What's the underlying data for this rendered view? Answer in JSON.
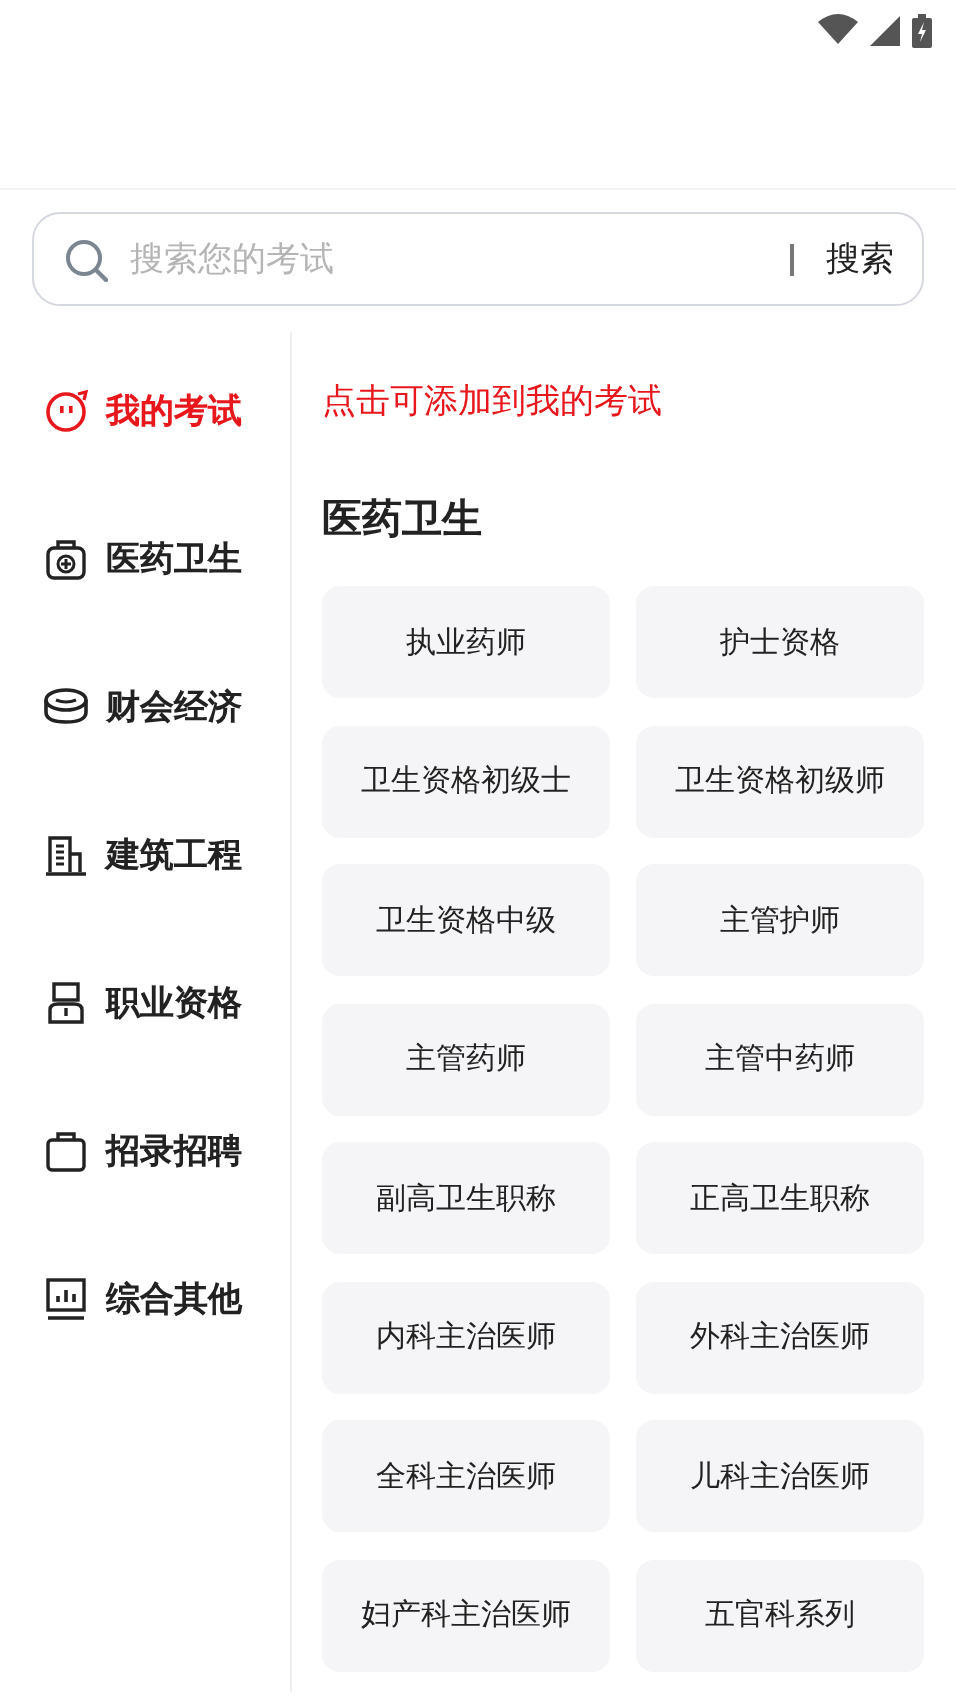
{
  "search": {
    "placeholder": "搜索您的考试",
    "button": "搜索"
  },
  "sidebar": {
    "items": [
      {
        "label": "我的考试",
        "selected": true
      },
      {
        "label": "医药卫生",
        "selected": false
      },
      {
        "label": "财会经济",
        "selected": false
      },
      {
        "label": "建筑工程",
        "selected": false
      },
      {
        "label": "职业资格",
        "selected": false
      },
      {
        "label": "招录招聘",
        "selected": false
      },
      {
        "label": "综合其他",
        "selected": false
      }
    ]
  },
  "content": {
    "hint": "点击可添加到我的考试",
    "section_title": "医药卫生",
    "exams": [
      "执业药师",
      "护士资格",
      "卫生资格初级士",
      "卫生资格初级师",
      "卫生资格中级",
      "主管护师",
      "主管药师",
      "主管中药师",
      "副高卫生职称",
      "正高卫生职称",
      "内科主治医师",
      "外科主治医师",
      "全科主治医师",
      "儿科主治医师",
      "妇产科主治医师",
      "五官科系列"
    ]
  }
}
